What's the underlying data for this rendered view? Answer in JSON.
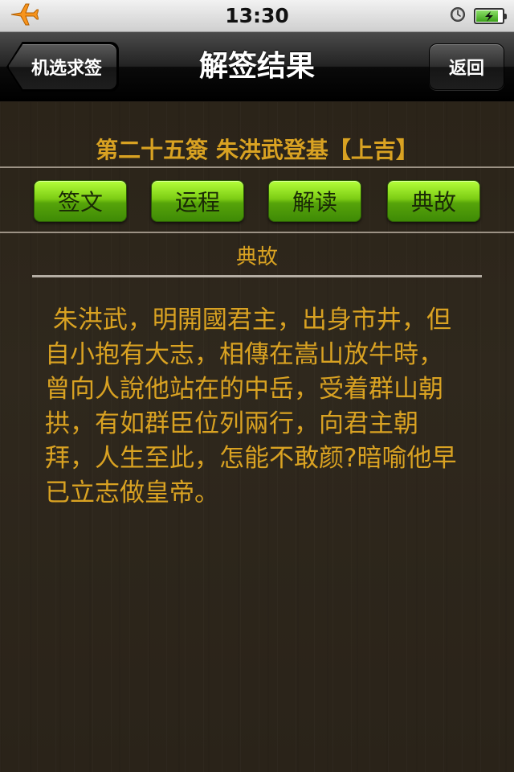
{
  "status_bar": {
    "time": "13:30"
  },
  "nav": {
    "title": "解签结果",
    "back_label": "机选求签",
    "right_label": "返回"
  },
  "fortune": {
    "title": "第二十五簽 朱洪武登基【上吉】"
  },
  "tabs": [
    {
      "label": "签文"
    },
    {
      "label": "运程"
    },
    {
      "label": "解读"
    },
    {
      "label": "典故"
    }
  ],
  "section": {
    "title": "典故",
    "text": " 朱洪武，明開國君主，出身市井，但自小抱有大志，相傳在嵩山放牛時，曾向人說他站在的中岳，受着群山朝拱，有如群臣位列兩行，向君主朝拜，人生至此，怎能不敢颜?暗喻他早已立志做皇帝。"
  },
  "colors": {
    "accent_text": "#d9a222",
    "tab_green": "#7ccc14"
  },
  "icons": {
    "airplane": "airplane-mode-icon",
    "alarm": "alarm-clock-icon",
    "battery": "battery-charging-icon"
  },
  "battery_level": 0.85
}
